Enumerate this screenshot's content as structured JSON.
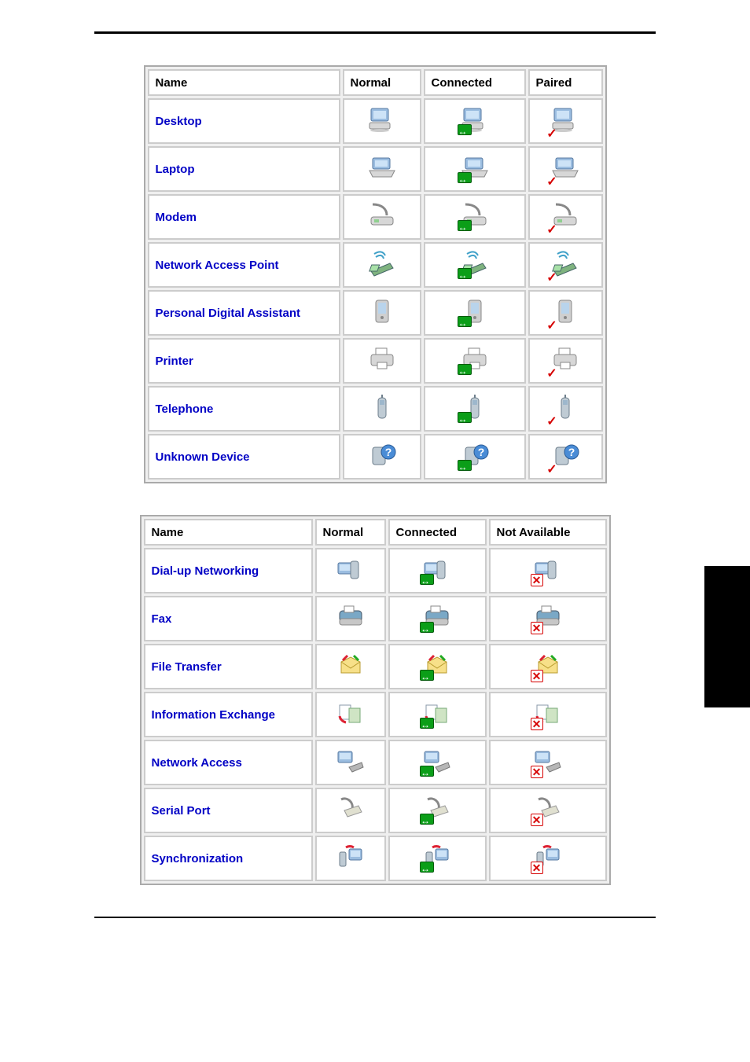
{
  "table1": {
    "headers": [
      "Name",
      "Normal",
      "Connected",
      "Paired"
    ],
    "rows": [
      {
        "name": "Desktop",
        "icon": "desktop"
      },
      {
        "name": "Laptop",
        "icon": "laptop"
      },
      {
        "name": "Modem",
        "icon": "modem"
      },
      {
        "name": "Network Access Point",
        "icon": "nap"
      },
      {
        "name": "Personal Digital Assistant",
        "icon": "pda"
      },
      {
        "name": "Printer",
        "icon": "printer"
      },
      {
        "name": "Telephone",
        "icon": "phone"
      },
      {
        "name": "Unknown Device",
        "icon": "unknown"
      }
    ]
  },
  "table2": {
    "headers": [
      "Name",
      "Normal",
      "Connected",
      "Not Available"
    ],
    "rows": [
      {
        "name": "Dial-up Networking",
        "icon": "dialup"
      },
      {
        "name": "Fax",
        "icon": "fax"
      },
      {
        "name": "File Transfer",
        "icon": "filetransfer"
      },
      {
        "name": "Information Exchange",
        "icon": "infoexchange"
      },
      {
        "name": "Network Access",
        "icon": "netaccess"
      },
      {
        "name": "Serial Port",
        "icon": "serial"
      },
      {
        "name": "Synchronization",
        "icon": "sync"
      }
    ]
  }
}
